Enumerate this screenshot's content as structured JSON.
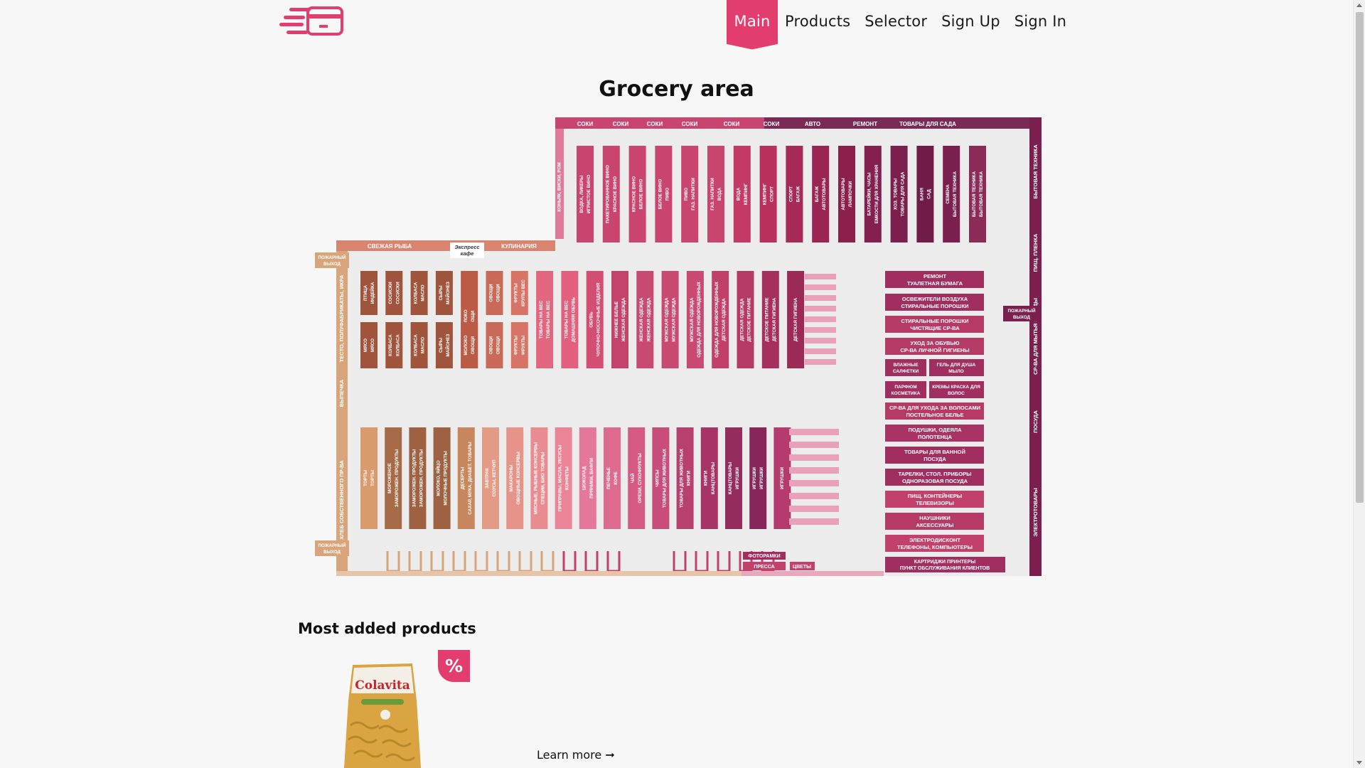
{
  "nav": {
    "items": [
      {
        "label": "Main",
        "active": true
      },
      {
        "label": "Products",
        "active": false
      },
      {
        "label": "Selector",
        "active": false
      },
      {
        "label": "Sign Up",
        "active": false
      },
      {
        "label": "Sign In",
        "active": false
      }
    ]
  },
  "page": {
    "title": "Grocery area"
  },
  "map": {
    "top_labels": [
      "СОКИ",
      "СОКИ",
      "СОКИ",
      "СОКИ",
      "СОКИ",
      "СОКИ",
      "АВТО",
      "РЕМОНТ",
      "ТОВАРЫ ДЛЯ САДА"
    ],
    "top_shelves": [
      "КОНЬЯК, ВИСКИ, РОМ",
      "ВОДКА, ЛИКЕРЫ / ИГРИСТОЕ ВИНО",
      "ПАКЕТИРОВАННОЕ ВИНО / КРАСНОЕ ВИНО",
      "КРАСНОЕ ВИНО / БЕЛОЕ ВИНО",
      "БЕЛОЕ ВИНО / ПИВО",
      "ПИВО / ГАЗ. НАПИТКИ",
      "ГАЗ. НАПИТКИ / ВОДА",
      "ВОДА / КЕМПИНГ",
      "КЕМПИНГ / СПОРТ",
      "СПОРТ / БАГАЖ",
      "БАГАЖ / АВТОТОВАРЫ",
      "АВТОТОВАРЫ / ЛАМПОЧКИ",
      "БАТАРЕЙКИ, ЧАСЫ / ЕМКОСТИ ДЛЯ ХРАНЕНИЯ",
      "ХОЗ. ТОВАРЫ / ТОВАРЫ ДЛЯ САДА",
      "БАНЯ / САД",
      "СЕМЕНА / БЫТОВАЯ ТЕХНИКА",
      "БЫТОВАЯ ТЕХНИКА / БЫТОВАЯ ТЕХНИКА"
    ],
    "side_right": [
      "БЫТОВАЯ ТЕХНИКА",
      "ПИЩ. ПЛЕНКА",
      "СР-ВА ДЛЯ МЫТЬЯ ПОСУДЫ",
      "ПОСУДА",
      "ЭЛЕКТРОТОВАРЫ"
    ],
    "side_left": [
      "ТЕСТО, ПОЛУФАБРИКАТЫ, ИКРА",
      "ВЫПЕЧКА",
      "ХЛЕБ СОБСТВЕННОГО ПР-ВА"
    ],
    "left_top_labels": [
      "СВЕЖАЯ РЫБА",
      "Экспресс кафе",
      "КУЛИНАРИЯ"
    ],
    "fire_exit": "ПОЖАРНЫЙ ВЫХОД",
    "middle_row1": [
      "ПТИЦА / ИНДЕЙКА",
      "СОСИСКИ / СОСИСКИ",
      "КОЛБАСА / МАСЛО",
      "СЫРЫ / МАЙОНЕЗ",
      "МОЛОКО / ОВОЩИ",
      "ОВОЩИ / ОВОЩИ",
      "ФРУКТЫ / КРУПЫ ВЕС",
      "ТОВАРЫ НА ВЕС / ТОВАРЫ НА ВЕС",
      "ТОВАРЫ НА ВЕС / ДОМАШНЯЯ ОБУВЬ",
      "ОБУВЬ / ЧУЛОЧНО-НОСОЧНЫЕ ИЗДЕЛИЯ",
      "НИЖНЕЕ БЕЛЬЕ / ЖЕНСКАЯ ОДЕЖДА",
      "ЖЕНСКАЯ ОДЕЖДА / ЖЕНСКАЯ ОДЕЖДА",
      "МУЖСКАЯ ОДЕЖДА / МУЖСКАЯ ОДЕЖДА",
      "МУЖСКАЯ ОДЕЖДА / ОДЕЖДА ДЛЯ НОВОРОЖДЕННЫХ",
      "ОДЕЖДА ДЛЯ НОВОРОЖДЕННЫХ / ДЕТСКАЯ ОДЕЖДА",
      "ДЕТСКАЯ ОДЕЖДА / ДЕТСКОЕ ПИТАНИЕ",
      "ДЕТСКОЕ ПИТАНИЕ / ДЕТСКАЯ ГИГИЕНА",
      "ДЕТСКАЯ ГИГИЕНА"
    ],
    "middle_row1_lower": [
      "МЯСО / МЯСО",
      "КОЛБАСА / КОЛБАСА",
      "ОВОЩИ / ОВОЩИ",
      "ФРУКТЫ / ФРУКТЫ"
    ],
    "middle_row2": [
      "ТОРТЫ / ТОРТЫ",
      "МОРОЖЕНОЕ / ЗАМОРОЖЕН. ПРОДУКТЫ",
      "ЗАМОРОЖЕН. ПРОДУКТЫ / ЗАМОРОЖЕН. ПРОДУКТЫ",
      "МОЛОКО, ЯЙЦО / МОЛОЧНЫЕ ПРОДУКТЫ",
      "ДЕСЕРТЫ / САХАР, МУКА, ДИАБЕТ. ТОВАРЫ",
      "ЗАВТРАК / СОУСЫ, КЕТЧУП",
      "МАКАРОНЫ / ОВОЩНЫЕ КОНСЕРВЫ",
      "МЯСНЫЕ, РЫБНЫЕ КОНСЕРВЫ / СПЕЦИИ, БИО ТОВАРЫ",
      "ПРИПРАВЫ, МАСЛА, УКСУСЫ / КОНФЕТЫ",
      "ШОКОЛАД / ПРЯНИКИ, ВАФЛИ",
      "ПЕЧЕНЬЕ / КОФЕ",
      "ЧАЙ / ОРЕХИ, СУХОФРУКТЫ",
      "ЧИПСЫ / ТОВАРЫ ДЛЯ ЖИВОТНЫХ",
      "ТОВАРЫ ДЛЯ ЖИВОТНЫХ / КНИГИ",
      "КНИГИ / КАНЦТОВАРЫ",
      "КАНЦТОВАРЫ / ИГРУШКИ",
      "ИГРУШКИ / ИГРУШКИ",
      "ИГРУШКИ"
    ],
    "right_blocks": [
      "РЕМОНТ / ТУАЛЕТНАЯ БУМАГА",
      "ОСВЕЖИТЕЛИ ВОЗДУХА / СТИРАЛЬНЫЕ ПОРОШКИ",
      "СТИРАЛЬНЫЕ ПОРОШКИ / ЧИСТЯЩИЕ СР-ВА",
      "УХОД ЗА ОБУВЬЮ / СР-ВА ЛИЧНОЙ ГИГИЕНЫ",
      "ВЛАЖНЫЕ САЛФЕТКИ | ГЕЛЬ ДЛЯ ДУША МЫЛО",
      "ПАРФЮМ КОСМЕТИКА | КРЕМЫ КРАСКА ДЛЯ ВОЛОС",
      "СР-ВА ДЛЯ УХОДА ЗА ВОЛОСАМИ / ПОСТЕЛЬНОЕ БЕЛЬЕ",
      "ПОДУШКИ, ОДЕЯЛА / ПОЛОТЕНЦА",
      "ТОВАРЫ ДЛЯ ВАННОЙ / ПОСУДА",
      "ТАРЕЛКИ, СТОЛ. ПРИБОРЫ / ОДНОРАЗОВАЯ ПОСУДА",
      "ПИЩ. КОНТЕЙНЕРЫ / ТЕЛЕВИЗОРЫ",
      "НАУШНИКИ / АКСЕССУАРЫ",
      "ЭЛЕКТРОДИСКОНТ / ТЕЛЕФОНЫ, КОМПЬЮТЕРЫ",
      "КАРТРИДЖИ | ПРИНТЕРЫ / ПУНКТ ОБСЛУЖИВАНИЯ КЛИЕНТОВ"
    ],
    "bottom_labels": [
      "ФОТОРАМКИ",
      "ПРЕССА",
      "ЦВЕТЫ"
    ]
  },
  "most_added": {
    "title": "Most added products",
    "product_brand": "Colavita",
    "discount_symbol": "%",
    "learn_more": "Learn more ➞"
  },
  "colors": {
    "accent": "#e23d6e",
    "dark_plum": "#7a1f4e",
    "rose": "#c2406c",
    "pink": "#e89ab3",
    "tan": "#c4906a",
    "brown": "#8a4a3a"
  }
}
